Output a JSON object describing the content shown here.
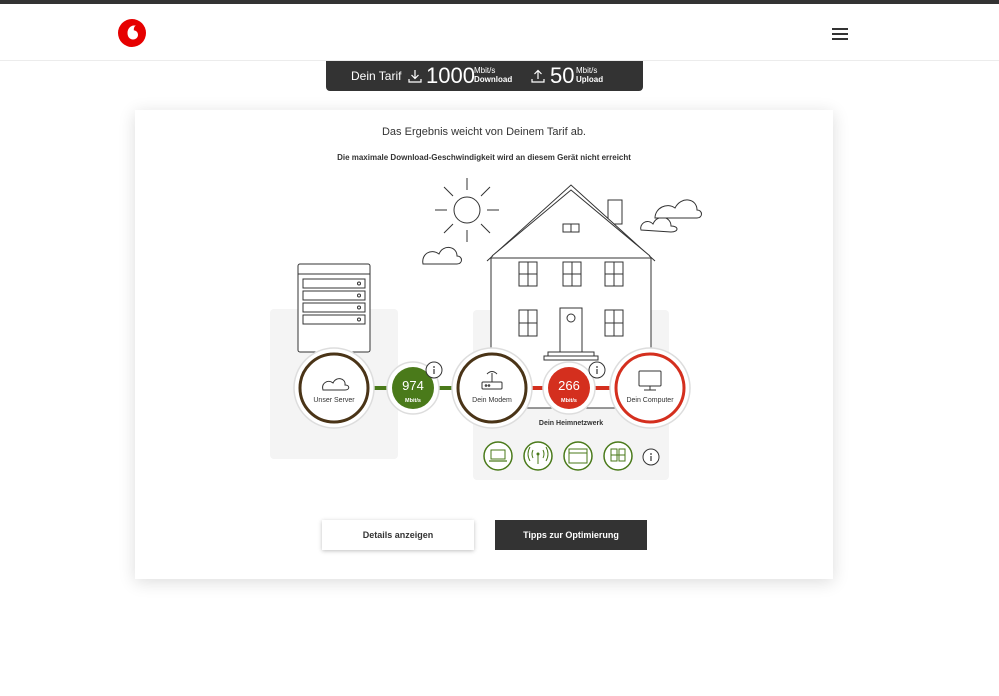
{
  "header": {
    "logo_icon": "vodafone-logo-icon",
    "menu_icon": "hamburger-menu-icon"
  },
  "tarif": {
    "label": "Dein Tarif",
    "download_value": "1000",
    "download_unit": "Mbit/s",
    "download_label": "Download",
    "upload_value": "50",
    "upload_unit": "Mbit/s",
    "upload_label": "Upload"
  },
  "result": {
    "headline": "Das Ergebnis weicht von Deinem Tarif ab.",
    "subline": "Die maximale Download-Geschwindigkeit wird an diesem Gerät nicht erreicht"
  },
  "diagram": {
    "server_label": "Unser Server",
    "modem_label": "Dein Modem",
    "computer_label": "Dein Computer",
    "speed1_value": "974",
    "speed1_unit": "Mbit/s",
    "speed2_value": "266",
    "speed2_unit": "Mbit/s",
    "network_label": "Dein Heimnetzwerk",
    "colors": {
      "good": "#4a7a1a",
      "bad": "#d42f1e",
      "ring_dark": "#4a3417"
    }
  },
  "buttons": {
    "details_label": "Details anzeigen",
    "tipps_label": "Tipps zur Optimierung"
  }
}
